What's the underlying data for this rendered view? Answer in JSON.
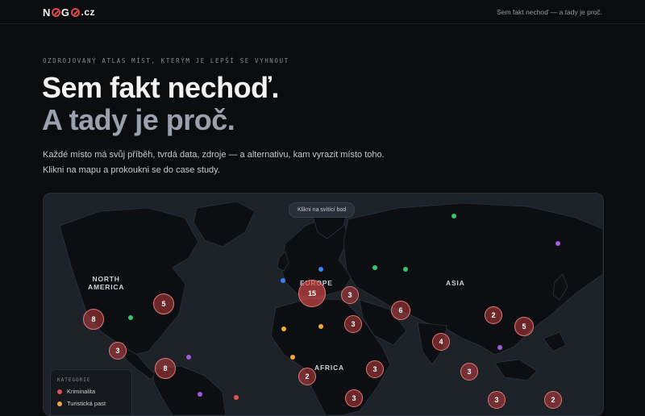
{
  "brand": {
    "logo_n": "N",
    "logo_g": "G",
    "logo_tld": ".cz"
  },
  "topbar": {
    "tagline": "Sem fakt nechoď — a tady je proč."
  },
  "hero": {
    "kicker": "OZDROJOVANÝ ATLAS MÍST, KTERÝM JE LEPŠÍ SE VYHNOUT",
    "title_line1": "Sem fakt nechoď.",
    "title_line2": "A tady je proč.",
    "lede": "Každé místo má svůj příběh, tvrdá data, zdroje — a alternativu, kam vyrazit místo toho. Klikni na mapu a prokoukni se do case study."
  },
  "map": {
    "hint": "Klikni na svítící bod",
    "regions": [
      {
        "name": "north-america",
        "label": "NORTH\nAMERICA"
      },
      {
        "name": "europe",
        "label": "EUROPE"
      },
      {
        "name": "asia",
        "label": "ASIA"
      },
      {
        "name": "africa",
        "label": "AFRICA"
      }
    ],
    "clusters": [
      "5",
      "8",
      "3",
      "8",
      "15",
      "3",
      "3",
      "6",
      "2",
      "5",
      "4",
      "3",
      "2",
      "3",
      "3",
      "3",
      "2"
    ],
    "colors": {
      "crime": "#e05252",
      "tourist_trap": "#f2a93b",
      "purple": "#a05be0",
      "green": "#34c76a",
      "blue": "#3b82f6"
    }
  },
  "legend": {
    "title": "KATEGORIE",
    "items": [
      {
        "label": "Kriminalita",
        "color": "#e05252"
      },
      {
        "label": "Turistická past",
        "color": "#f2a93b"
      }
    ]
  }
}
